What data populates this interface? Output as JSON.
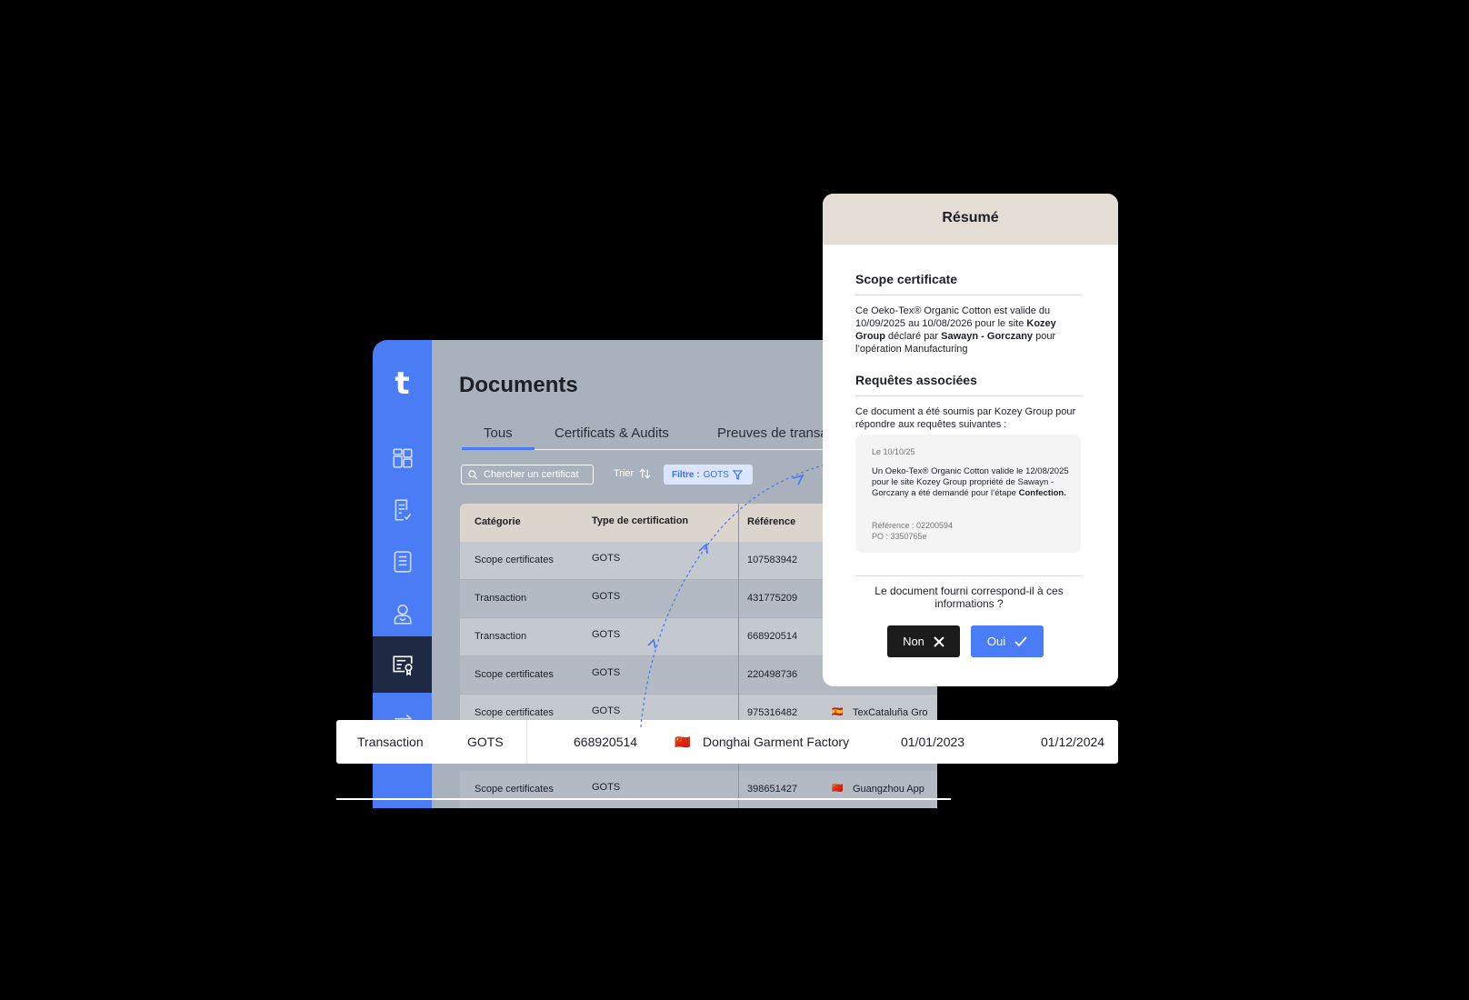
{
  "app": {
    "logo": "t",
    "nav": [
      {
        "name": "dashboard-icon"
      },
      {
        "name": "document-check-icon"
      },
      {
        "name": "list-document-icon"
      },
      {
        "name": "user-icon"
      },
      {
        "name": "certificate-icon",
        "active": true
      },
      {
        "name": "transfer-icon"
      }
    ],
    "title": "Documents",
    "tabs": [
      "Tous",
      "Certificats & Audits",
      "Preuves de transa"
    ],
    "search_placeholder": "Chercher un certificat",
    "sort_label": "Trier",
    "filter_prefix": "Filtre :",
    "filter_value": "GOTS",
    "table": {
      "headers": [
        "Catégorie",
        "Type de certification",
        "Référence"
      ],
      "rows": [
        {
          "category": "Scope certificates",
          "type": "GOTS",
          "ref": "107583942",
          "flag": "",
          "company": ""
        },
        {
          "category": "Transaction",
          "type": "GOTS",
          "ref": "431775209",
          "flag": "",
          "company": ""
        },
        {
          "category": "Transaction",
          "type": "GOTS",
          "ref": "668920514",
          "flag": "",
          "company": ""
        },
        {
          "category": "Scope certificates",
          "type": "GOTS",
          "ref": "220498736",
          "flag": "",
          "company": ""
        },
        {
          "category": "Scope certificates",
          "type": "GOTS",
          "ref": "975316482",
          "flag": "🇪🇸",
          "company": "TexCataluña Gro"
        },
        {
          "category": "Scope certificates",
          "type": "GOTS",
          "ref": "398651427",
          "flag": "🇨🇳",
          "company": "Guangzhou App"
        }
      ]
    }
  },
  "highlight_row": {
    "category": "Transaction",
    "type": "GOTS",
    "ref": "668920514",
    "flag": "🇨🇳",
    "company": "Donghai Garment Factory",
    "start": "01/01/2023",
    "end": "01/12/2024"
  },
  "summary": {
    "title": "Résumé",
    "scope_title": "Scope certificate",
    "scope_text_1": "Ce Oeko-Tex® Organic Cotton est valide du 10/09/2025 au 10/08/2026 pour le site ",
    "scope_bold_1": "Kozey Group",
    "scope_text_2": " déclaré par ",
    "scope_bold_2": "Sawayn - Gorczany",
    "scope_text_3": " pour l’opération Manufacturing",
    "req_title": "Requêtes associées",
    "req_intro": "Ce document a été soumis par Kozey Group pour répondre aux requêtes suivantes :",
    "req_date": "Le 10/10/25",
    "req_text": "Un Oeko-Tex® Organic Cotton valide le 12/08/2025 pour le site Kozey Group propriété de Sawayn - Gorczany a été demandé pour l’étape ",
    "req_bold": "Confection.",
    "req_ref": "Référence : 02200594",
    "req_po": "PO : 3350765e",
    "question": "Le document fourni correspond-il à ces informations ?",
    "btn_no": "Non",
    "btn_yes": "Oui"
  },
  "colors": {
    "accent": "#4a7cf6",
    "dark": "#1b1b1b",
    "card_header": "#e4ddd6"
  }
}
